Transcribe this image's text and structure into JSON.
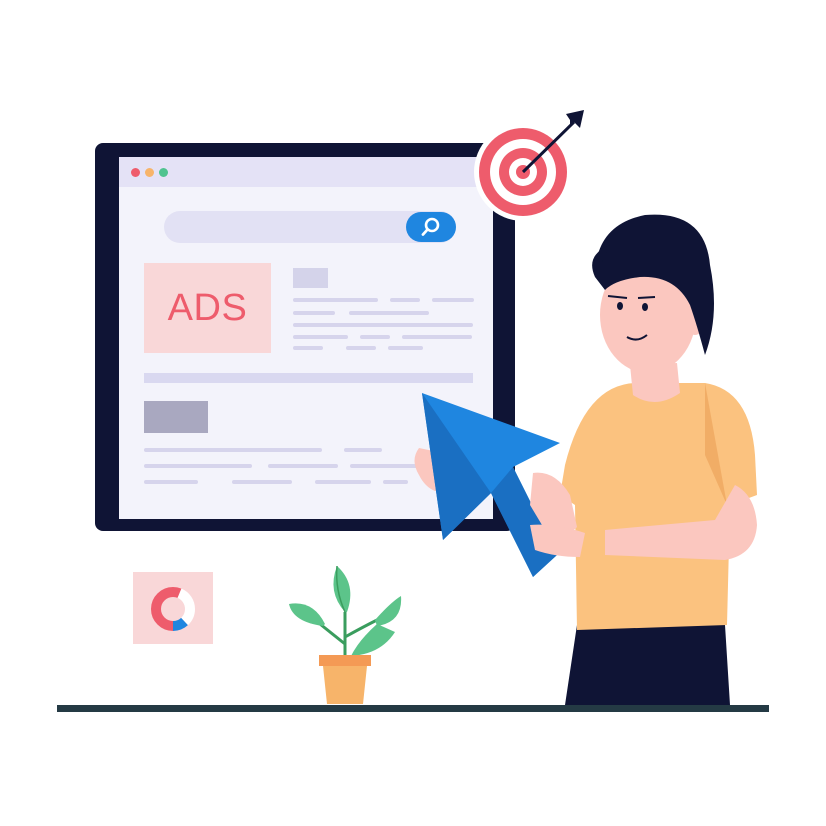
{
  "browser_window": {
    "ad_label": "ADS"
  },
  "colors": {
    "monitor_frame": "#0f1435",
    "screen_bg": "#f3f3fb",
    "titlebar_bg": "#e4e2f6",
    "search_button": "#1f86e0",
    "ad_box_bg": "#f9d7d8",
    "ad_text": "#ee5c6c",
    "target_red": "#ee5c6c",
    "cursor_blue": "#1f86e0",
    "shirt": "#fbc27f",
    "hair": "#0f1435",
    "skin": "#fbc7bf",
    "pants": "#0f1435",
    "leaf_green": "#5cc48a",
    "pot": "#f7b46a",
    "floor": "#243a44"
  },
  "icons": {
    "window_dots": [
      "red-dot-icon",
      "yellow-dot-icon",
      "green-dot-icon"
    ],
    "search": "magnifier-icon",
    "target": "bullseye-target-icon",
    "arrow": "arrow-in-target-icon",
    "cursor": "mouse-pointer-icon",
    "chart": "donut-chart-icon",
    "plant": "potted-plant-icon"
  }
}
